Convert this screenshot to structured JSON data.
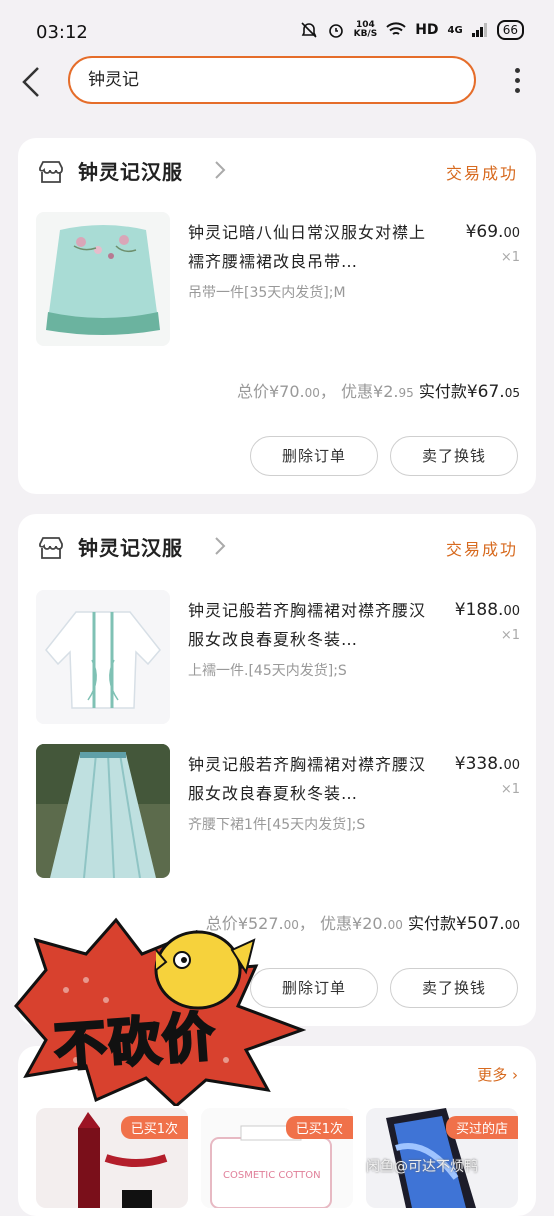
{
  "status_bar": {
    "time": "03:12",
    "net_speed_value": "104",
    "net_speed_unit": "KB/S",
    "hd": "HD",
    "signal": "4G",
    "battery": "66"
  },
  "search": {
    "query": "钟灵记"
  },
  "orders": [
    {
      "shop": "钟灵记汉服",
      "status": "交易成功",
      "items": [
        {
          "title": "钟灵记暗八仙日常汉服女对襟上襦齐腰襦裙改良吊带…",
          "spec": "吊带一件[35天内发货];M",
          "price_int": "¥69.",
          "price_dec": "00",
          "qty": "×1"
        }
      ],
      "totals": {
        "total_label": "总价",
        "total_int": "¥70.",
        "total_dec": "00",
        "sep": "，",
        "discount_label": "优惠",
        "discount_int": "¥2.",
        "discount_dec": "95",
        "paid_label": "实付款",
        "paid_int": "¥67.",
        "paid_dec": "05"
      },
      "buttons": [
        "删除订单",
        "卖了换钱"
      ]
    },
    {
      "shop": "钟灵记汉服",
      "status": "交易成功",
      "items": [
        {
          "title": "钟灵记般若齐胸襦裙对襟齐腰汉服女改良春夏秋冬装…",
          "spec": "上襦一件.[45天内发货];S",
          "price_int": "¥188.",
          "price_dec": "00",
          "qty": "×1"
        },
        {
          "title": "钟灵记般若齐胸襦裙对襟齐腰汉服女改良春夏秋冬装…",
          "spec": "齐腰下裙1件[45天内发货];S",
          "price_int": "¥338.",
          "price_dec": "00",
          "qty": "×1"
        }
      ],
      "totals": {
        "total_label": "总价",
        "total_int": "¥527.",
        "total_dec": "00",
        "sep": "，",
        "discount_label": "优惠",
        "discount_int": "¥20.",
        "discount_dec": "00",
        "paid_label": "实付款",
        "paid_int": "¥507.",
        "paid_dec": "00"
      },
      "buttons": [
        "删除订单",
        "卖了换钱"
      ]
    }
  ],
  "recommend": {
    "more": "更多",
    "cards": [
      {
        "tag": "已买1次",
        "label": ""
      },
      {
        "tag": "已买1次",
        "label": "COSMETIC COTTON"
      },
      {
        "tag": "买过的店",
        "label": ""
      }
    ]
  },
  "sticker_text": "不砍价",
  "watermark": "闲鱼@可达不烦鸭",
  "colors": {
    "accent": "#e56d2a",
    "status": "#d76a1f",
    "background": "#f3f1f4",
    "tag": "#f0714a"
  }
}
